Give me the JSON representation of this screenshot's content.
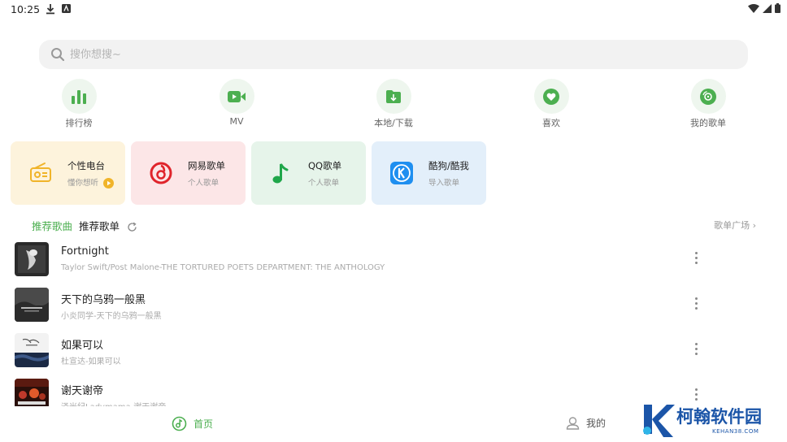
{
  "status_bar": {
    "time": "10:25"
  },
  "search": {
    "placeholder": "搜你想搜~",
    "value": ""
  },
  "quick_nav": [
    {
      "label": "排行榜",
      "icon": "bar-chart-icon"
    },
    {
      "label": "MV",
      "icon": "video-icon"
    },
    {
      "label": "本地/下载",
      "icon": "download-folder-icon"
    },
    {
      "label": "喜欢",
      "icon": "heart-icon"
    },
    {
      "label": "我的歌单",
      "icon": "disc-icon"
    }
  ],
  "cards": [
    {
      "title": "个性电台",
      "subtitle": "懂你想听",
      "bg": "#fdf3dc",
      "icon": "radio-icon"
    },
    {
      "title": "网易歌单",
      "subtitle": "个人歌单",
      "bg": "#fce6e7",
      "icon": "netease-music-icon"
    },
    {
      "title": "QQ歌单",
      "subtitle": "个人歌单",
      "bg": "#e6f4ea",
      "icon": "qq-music-note-icon"
    },
    {
      "title": "酷狗/酷我",
      "subtitle": "导入歌单",
      "bg": "#e3effa",
      "icon": "kugou-k-icon"
    }
  ],
  "section": {
    "tab_songs": "推荐歌曲",
    "tab_playlists": "推荐歌单",
    "more_label": "歌单广场 ›"
  },
  "songs": [
    {
      "title": "Fortnight",
      "subtitle": "Taylor Swift/Post Malone-THE TORTURED POETS DEPARTMENT: THE ANTHOLOGY"
    },
    {
      "title": "天下的乌鸦一般黑",
      "subtitle": "小炎同学-天下的乌鸦一般黑"
    },
    {
      "title": "如果可以",
      "subtitle": "杜宣达-如果可以"
    },
    {
      "title": "谢天谢帝",
      "subtitle": "泽米纪Ladymama-谢天谢帝"
    }
  ],
  "bottom_nav": {
    "home_label": "首页",
    "me_label": "我的"
  },
  "watermark": {
    "text": "柯翰软件园",
    "sub": "KEHAN38.COM"
  },
  "colors": {
    "accent": "#4caf50",
    "watermark": "#1b55a8"
  }
}
